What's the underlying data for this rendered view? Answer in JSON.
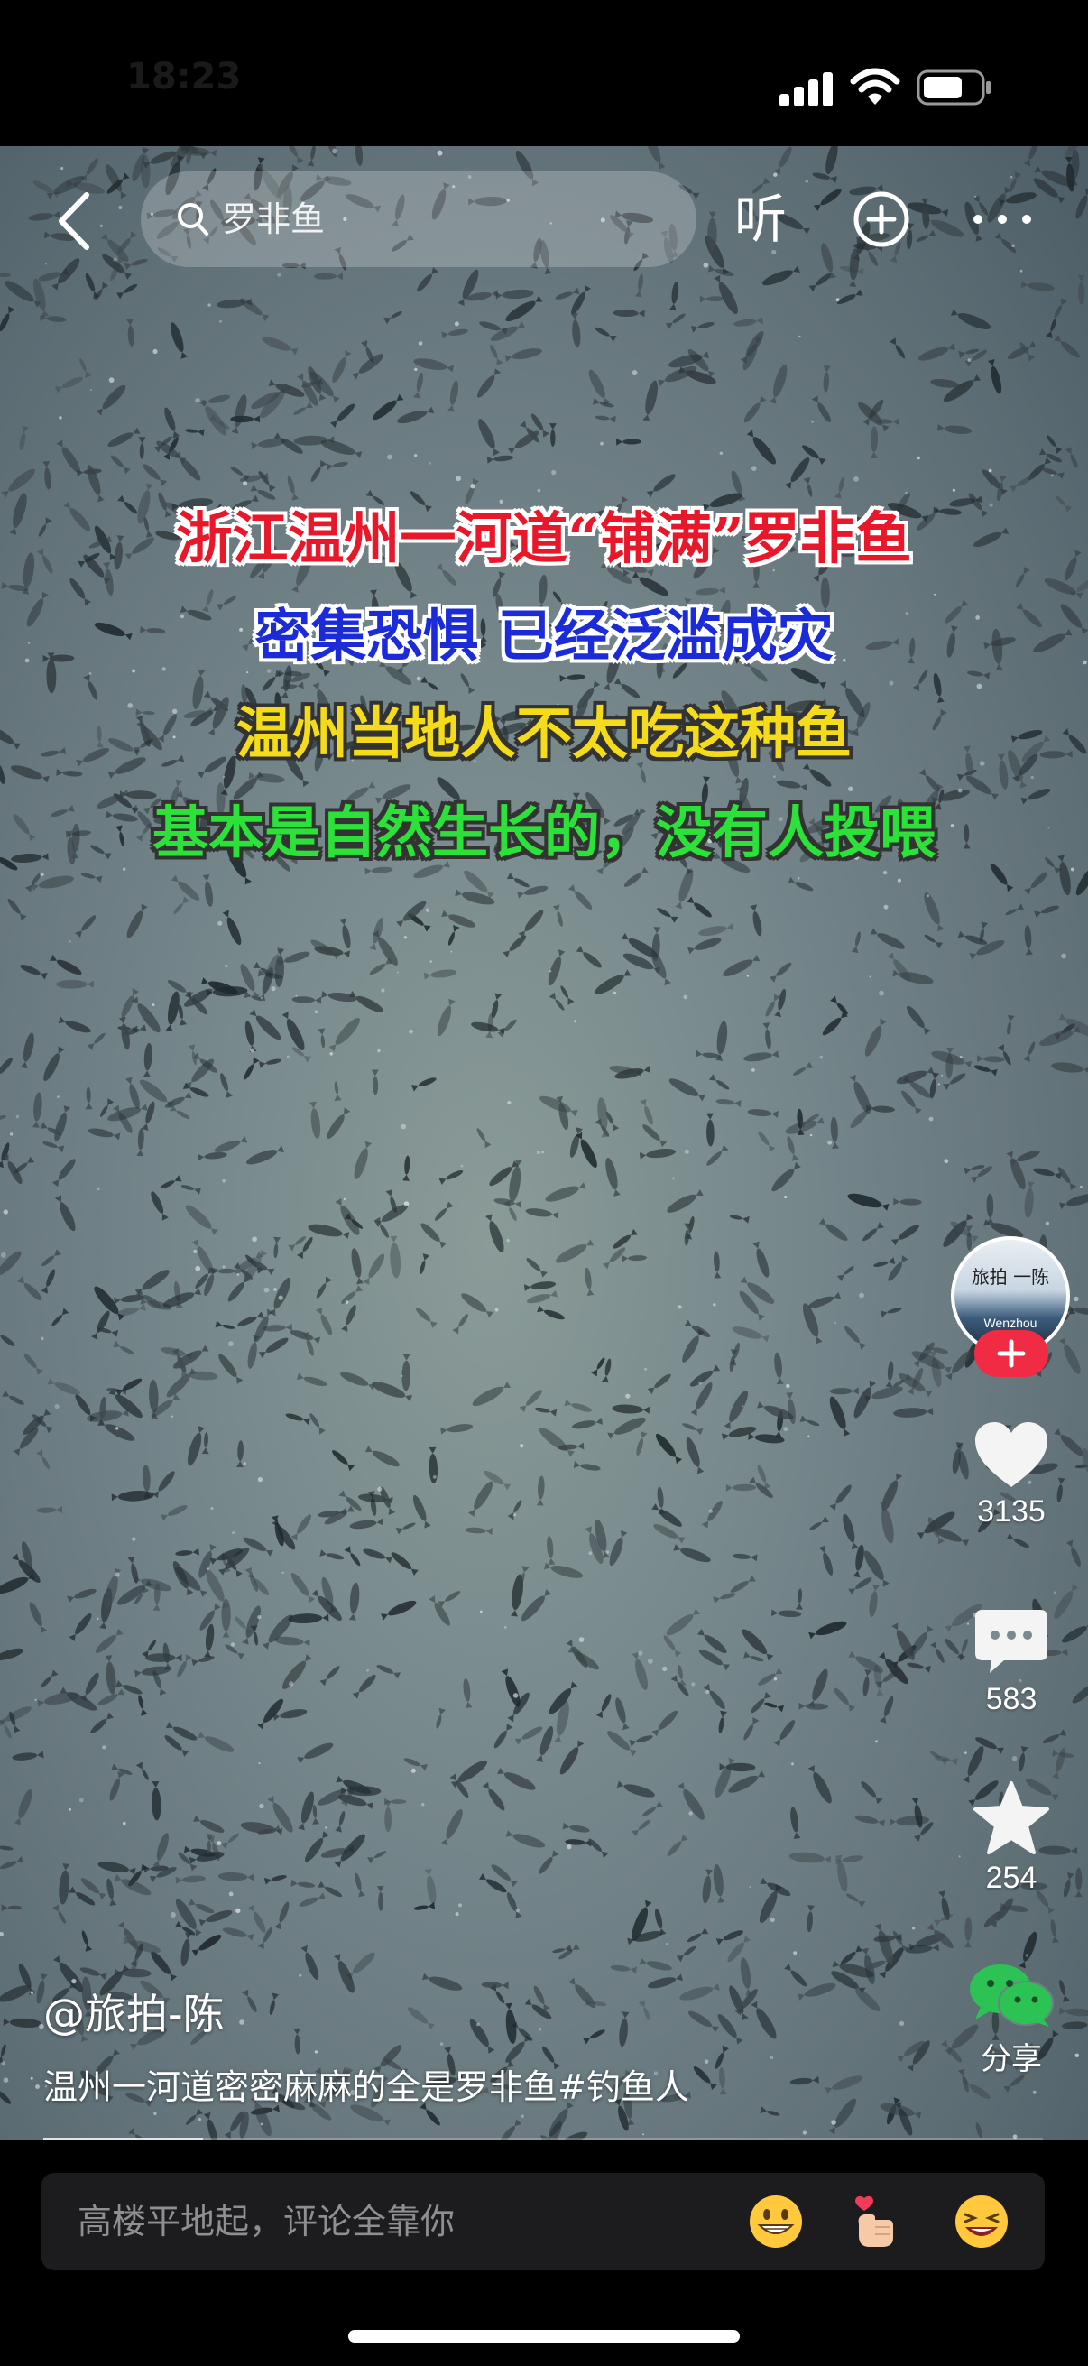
{
  "status_bar": {
    "time": "18:23"
  },
  "search": {
    "query": "罗非鱼"
  },
  "top_bar": {
    "listen_label": "听"
  },
  "video": {
    "caption_lines": [
      "浙江温州一河道“铺满”罗非鱼",
      "密集恐惧 已经泛滥成灾",
      "温州当地人不太吃这种鱼",
      "基本是自然生长的，没有人投喂"
    ],
    "caption_colors": [
      "#e8182a",
      "#1c2bd8",
      "#f5dc1a",
      "#2ce23a"
    ]
  },
  "creator": {
    "avatar_text": "旅拍 一陈",
    "avatar_sub": "Wenzhou",
    "handle": "@旅拍-陈"
  },
  "actions": {
    "likes": "3135",
    "comments": "583",
    "favorites": "254",
    "share_label": "分享"
  },
  "description": "温州一河道密密麻麻的全是罗非鱼#钓鱼人",
  "progress": 0.16,
  "comment_bar": {
    "placeholder": "高楼平地起，评论全靠你",
    "emojis": [
      "grinning-face-icon",
      "heart-finger-icon",
      "laughing-face-icon"
    ]
  },
  "colors": {
    "follow_accent": "#f22b45",
    "wechat_green": "#2dc254"
  }
}
